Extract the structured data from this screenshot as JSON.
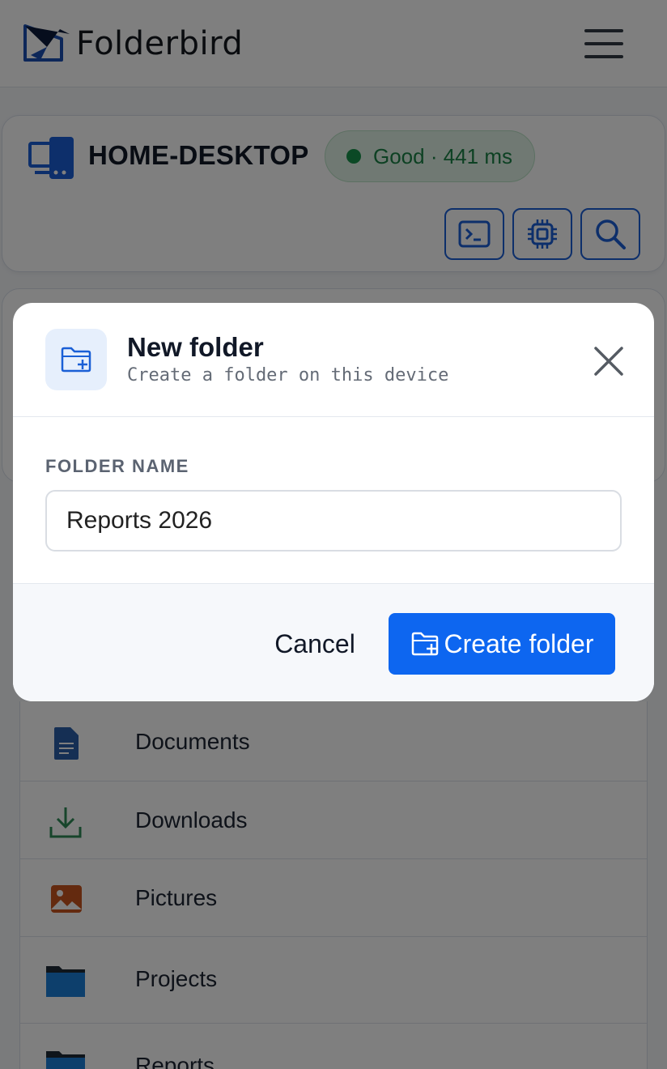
{
  "header": {
    "app_name": "Folderbird",
    "logo_icon": "bird-folder-logo",
    "menu_icon": "hamburger-icon"
  },
  "device": {
    "name": "HOME-DESKTOP",
    "status_text": "Good · 441 ms",
    "status_color": "#17924a",
    "tools": [
      "terminal-icon",
      "cpu-icon",
      "search-icon"
    ]
  },
  "folders": [
    {
      "name": "Documents",
      "icon": "document-icon"
    },
    {
      "name": "Downloads",
      "icon": "download-icon"
    },
    {
      "name": "Pictures",
      "icon": "image-icon"
    },
    {
      "name": "Projects",
      "icon": "folder-icon"
    },
    {
      "name": "Reports",
      "icon": "folder-icon"
    }
  ],
  "modal": {
    "title": "New folder",
    "subtitle": "Create a folder on this device",
    "field_label": "FOLDER NAME",
    "field_value": "Reports 2026",
    "cancel_label": "Cancel",
    "create_label": "Create folder",
    "accent": "#0d66f0"
  }
}
